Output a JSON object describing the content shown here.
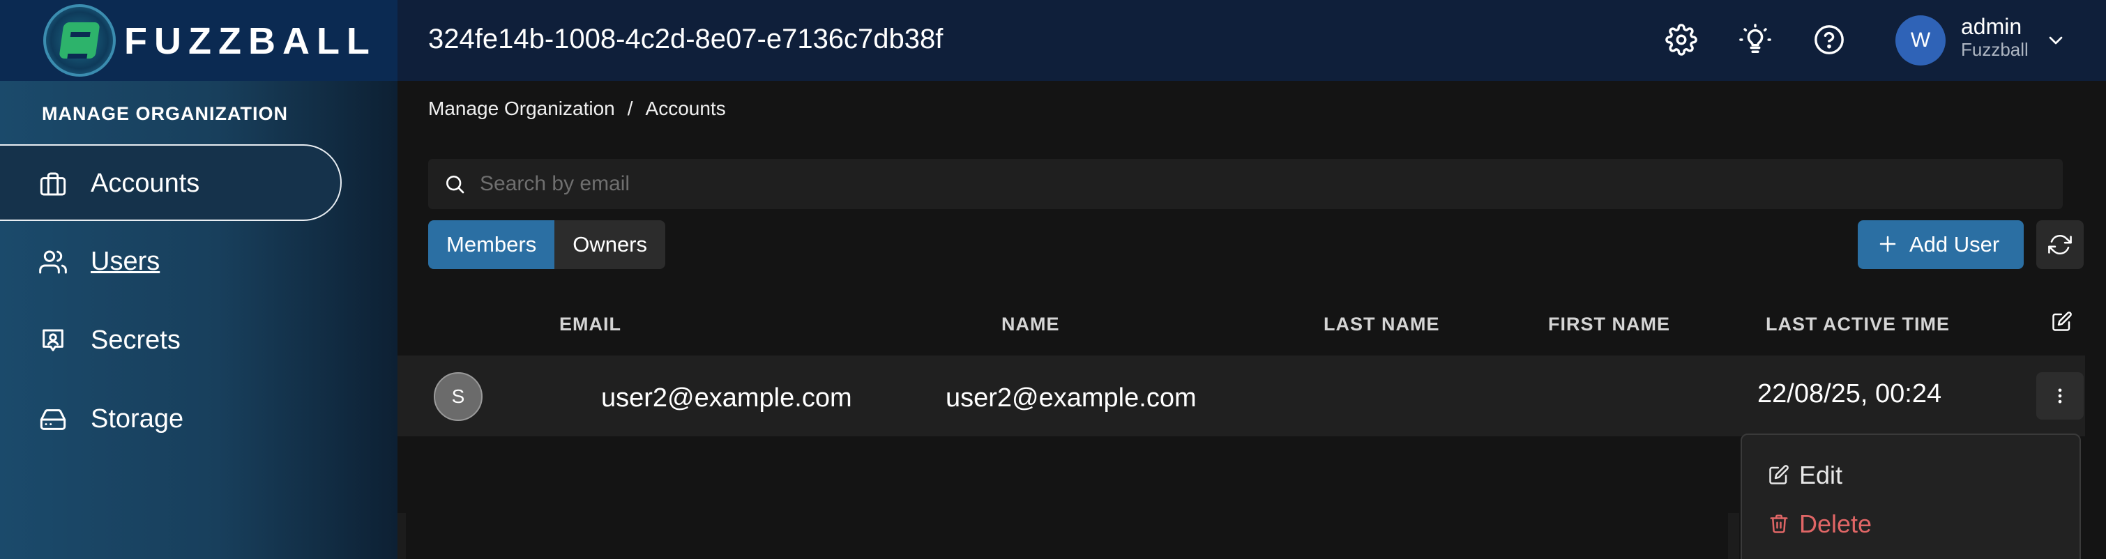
{
  "brand": {
    "name": "FUZZBALL"
  },
  "header": {
    "org_id": "324fe14b-1008-4c2d-8e07-e7136c7db38f",
    "icons": [
      "gear-icon",
      "lightbulb-icon",
      "help-circle-icon"
    ],
    "user": {
      "initial": "W",
      "name": "admin",
      "org": "Fuzzball"
    }
  },
  "sidebar": {
    "heading": "MANAGE ORGANIZATION",
    "items": [
      {
        "label": "Accounts",
        "icon": "briefcase-icon",
        "active": true
      },
      {
        "label": "Users",
        "icon": "users-icon",
        "active": false
      },
      {
        "label": "Secrets",
        "icon": "secret-icon",
        "active": false
      },
      {
        "label": "Storage",
        "icon": "hard-drive-icon",
        "active": false
      }
    ]
  },
  "breadcrumb": {
    "parent": "Manage Organization",
    "separator": "/",
    "current": "Accounts"
  },
  "search": {
    "placeholder": "Search by email",
    "value": ""
  },
  "toggle": {
    "members_label": "Members",
    "owners_label": "Owners",
    "selected": "Members"
  },
  "actions": {
    "add_user_label": "Add User"
  },
  "table": {
    "headers": {
      "email": "EMAIL",
      "name": "NAME",
      "last_name": "LAST NAME",
      "first_name": "FIRST NAME",
      "last_active": "LAST ACTIVE TIME"
    },
    "rows": [
      {
        "initial": "S",
        "email": "user2@example.com",
        "name": "user2@example.com",
        "last_name": "",
        "first_name": "",
        "last_active": "22/08/25, 00:24"
      }
    ]
  },
  "context_menu": {
    "edit_label": "Edit",
    "delete_label": "Delete"
  },
  "colors": {
    "accent": "#2b6fa3",
    "danger": "#e06666",
    "topbar": "#0f1f3a"
  }
}
